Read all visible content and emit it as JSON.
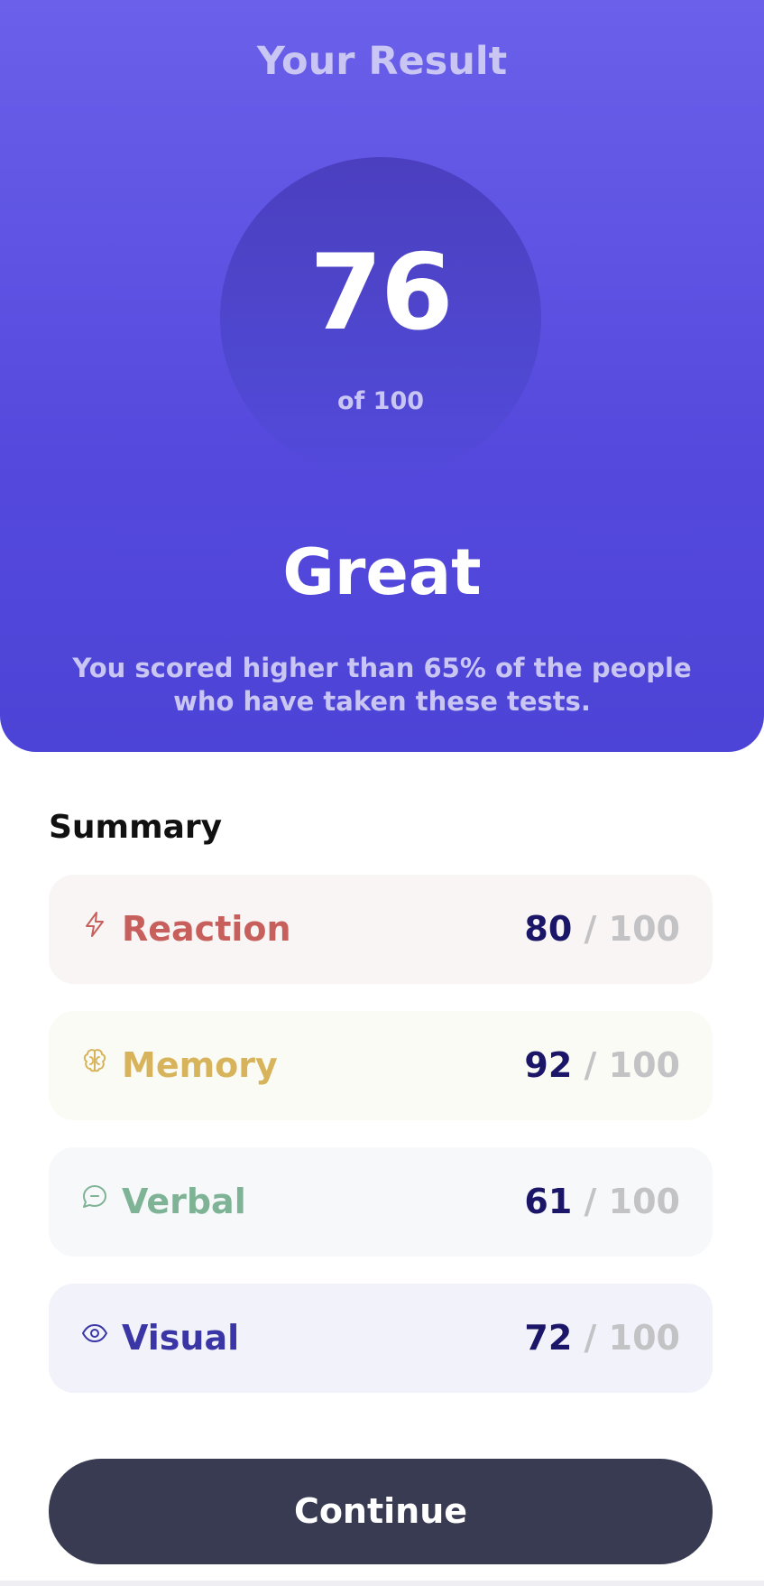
{
  "result": {
    "title": "Your Result",
    "score": "76",
    "score_total": "of 100",
    "rating": "Great",
    "description": "You scored higher than 65% of the people who have taken these tests."
  },
  "summary": {
    "heading": "Summary",
    "items": [
      {
        "label": "Reaction",
        "score": "80",
        "separator": "/",
        "max": "100",
        "icon": "lightning-icon",
        "color": "#c7605c",
        "bg": "#f9f5f4"
      },
      {
        "label": "Memory",
        "score": "92",
        "separator": "/",
        "max": "100",
        "icon": "brain-icon",
        "color": "#d7b45b",
        "bg": "#fbfbf6"
      },
      {
        "label": "Verbal",
        "score": "61",
        "separator": "/",
        "max": "100",
        "icon": "chat-bubble-icon",
        "color": "#7fb396",
        "bg": "#f7f8fa"
      },
      {
        "label": "Visual",
        "score": "72",
        "separator": "/",
        "max": "100",
        "icon": "eye-icon",
        "color": "#3b36a6",
        "bg": "#f1f2fa"
      }
    ]
  },
  "actions": {
    "continue_label": "Continue"
  },
  "colors": {
    "gradient_top": "#6a60ea",
    "gradient_bottom": "#4c44d6",
    "button_bg": "#383b52",
    "score_value": "#1b1668",
    "score_max": "#c3c3c6"
  }
}
